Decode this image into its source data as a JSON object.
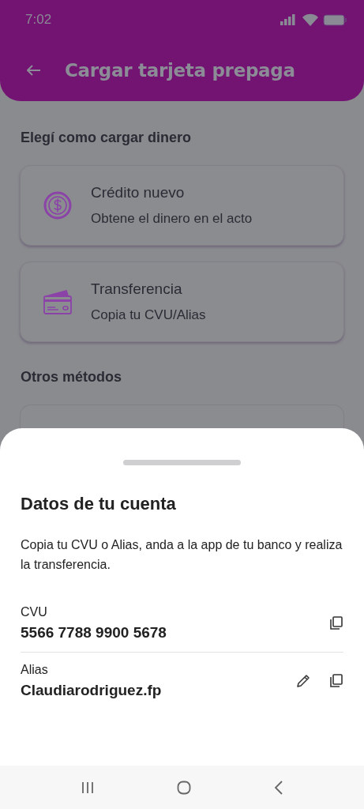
{
  "status_bar": {
    "time": "7:02"
  },
  "header": {
    "title": "Cargar tarjeta prepaga"
  },
  "section_title": "Elegí como cargar dinero",
  "options": [
    {
      "kind": "credit",
      "title": "Crédito nuevo",
      "subtitle": "Obtene el dinero en el acto"
    },
    {
      "kind": "transfer",
      "title": "Transferencia",
      "subtitle": "Copia tu CVU/Alias"
    }
  ],
  "other_title": "Otros métodos",
  "sheet": {
    "title": "Datos de tu cuenta",
    "description": "Copia tu CVU o Alias, anda a la app de tu banco y realiza la transferencia.",
    "fields": [
      {
        "label": "CVU",
        "value": "5566 7788 9900 5678",
        "editable": false
      },
      {
        "label": "Alias",
        "value": "Claudiarodriguez.fp",
        "editable": true
      }
    ]
  }
}
